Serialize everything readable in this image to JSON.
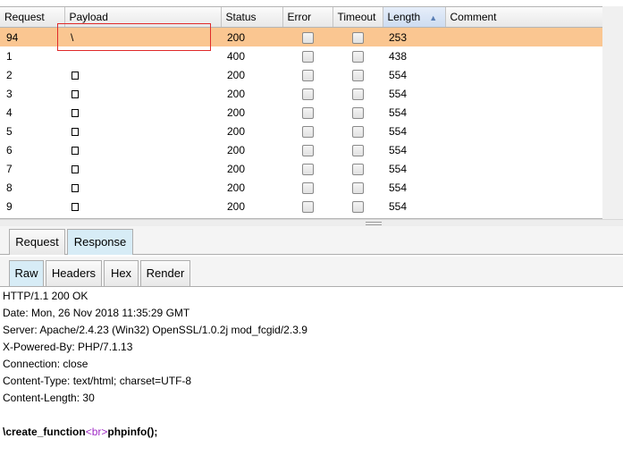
{
  "results_table": {
    "columns": [
      {
        "key": "request",
        "label": "Request"
      },
      {
        "key": "payload",
        "label": "Payload"
      },
      {
        "key": "status",
        "label": "Status"
      },
      {
        "key": "error",
        "label": "Error"
      },
      {
        "key": "timeout",
        "label": "Timeout"
      },
      {
        "key": "length",
        "label": "Length",
        "sorted": "ascending"
      },
      {
        "key": "comment",
        "label": "Comment"
      }
    ],
    "rows": [
      {
        "request": "94",
        "payload": "\\",
        "payload_glyph": false,
        "status": "200",
        "error": false,
        "timeout": false,
        "length": "253",
        "comment": "",
        "selected": true
      },
      {
        "request": "1",
        "payload": "",
        "payload_glyph": false,
        "status": "400",
        "error": false,
        "timeout": false,
        "length": "438",
        "comment": "",
        "selected": false
      },
      {
        "request": "2",
        "payload": "",
        "payload_glyph": true,
        "status": "200",
        "error": false,
        "timeout": false,
        "length": "554",
        "comment": "",
        "selected": false
      },
      {
        "request": "3",
        "payload": "",
        "payload_glyph": true,
        "status": "200",
        "error": false,
        "timeout": false,
        "length": "554",
        "comment": "",
        "selected": false
      },
      {
        "request": "4",
        "payload": "",
        "payload_glyph": true,
        "status": "200",
        "error": false,
        "timeout": false,
        "length": "554",
        "comment": "",
        "selected": false
      },
      {
        "request": "5",
        "payload": "",
        "payload_glyph": true,
        "status": "200",
        "error": false,
        "timeout": false,
        "length": "554",
        "comment": "",
        "selected": false
      },
      {
        "request": "6",
        "payload": "",
        "payload_glyph": true,
        "status": "200",
        "error": false,
        "timeout": false,
        "length": "554",
        "comment": "",
        "selected": false
      },
      {
        "request": "7",
        "payload": "",
        "payload_glyph": true,
        "status": "200",
        "error": false,
        "timeout": false,
        "length": "554",
        "comment": "",
        "selected": false
      },
      {
        "request": "8",
        "payload": "",
        "payload_glyph": true,
        "status": "200",
        "error": false,
        "timeout": false,
        "length": "554",
        "comment": "",
        "selected": false
      },
      {
        "request": "9",
        "payload": "",
        "payload_glyph": true,
        "status": "200",
        "error": false,
        "timeout": false,
        "length": "554",
        "comment": "",
        "selected": false
      }
    ]
  },
  "colors": {
    "selected_row": "#fac691",
    "highlight_box": "#e02a2a",
    "active_tab": "#d7ecf6",
    "html_tag": "#a02cc6"
  },
  "view_tabs": {
    "request": "Request",
    "response": "Response",
    "active": "Response"
  },
  "format_tabs": {
    "raw": "Raw",
    "headers": "Headers",
    "hex": "Hex",
    "render": "Render",
    "active": "Raw"
  },
  "response": {
    "headers": [
      "HTTP/1.1 200 OK",
      "Date: Mon, 26 Nov 2018 11:35:29 GMT",
      "Server: Apache/2.4.23 (Win32) OpenSSL/1.0.2j mod_fcgid/2.3.9",
      "X-Powered-By: PHP/7.1.13",
      "Connection: close",
      "Content-Type: text/html; charset=UTF-8",
      "Content-Length: 30"
    ],
    "body_prefix": "\\create_function",
    "body_tag": "<br>",
    "body_suffix": "phpinfo();"
  }
}
